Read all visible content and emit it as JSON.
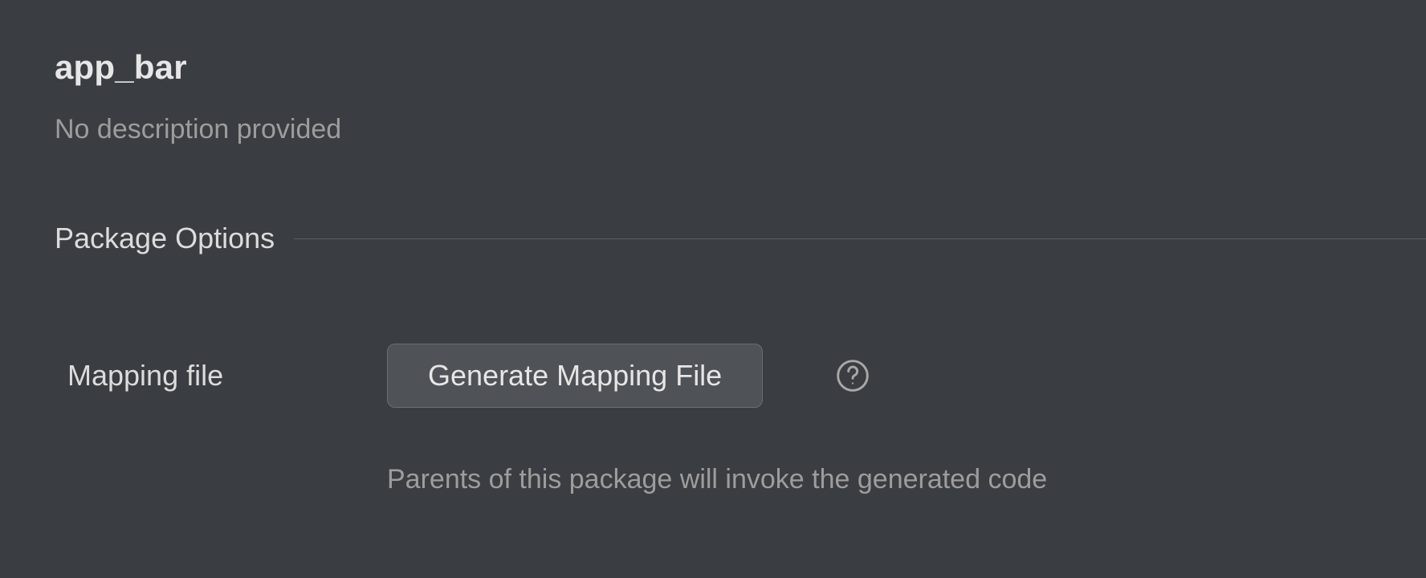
{
  "package": {
    "name": "app_bar",
    "description": "No description provided"
  },
  "section": {
    "title": "Package Options"
  },
  "options": {
    "mapping_file": {
      "label": "Mapping file",
      "button_label": "Generate Mapping File",
      "hint": "Parents of this package will invoke the generated code"
    }
  }
}
